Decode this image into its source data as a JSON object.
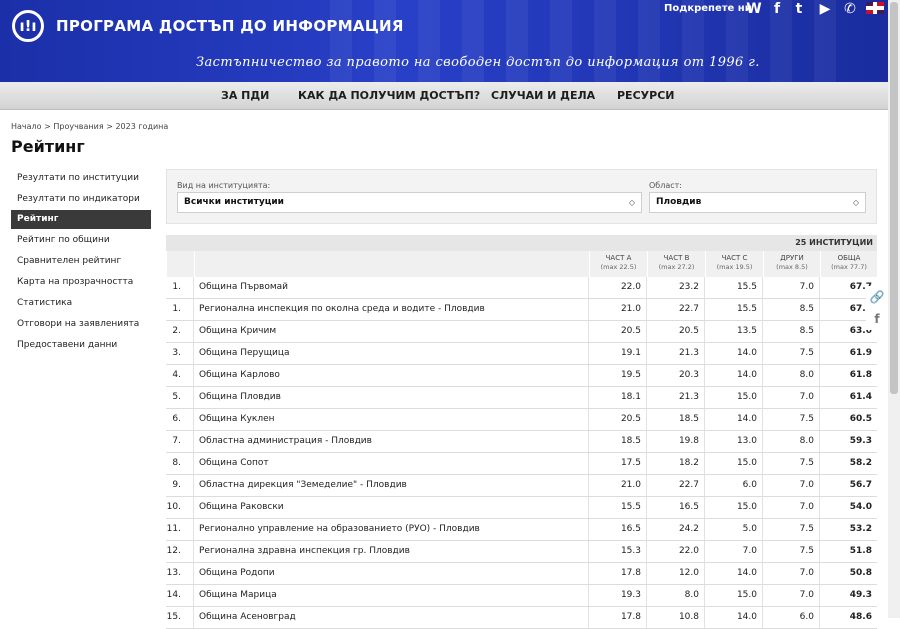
{
  "header": {
    "logo_text": "ı!ı",
    "title": "ПРОГРАМА ДОСТЪП ДО ИНФОРМАЦИЯ",
    "motto": "Застъпничество за правото на свободен достъп до информация от 1996 г.",
    "support_label": "Подкрепете ни",
    "icons": [
      "wordpress-icon",
      "facebook-icon",
      "twitter-icon",
      "youtube-icon",
      "phone-icon",
      "uk-flag-icon"
    ],
    "icon_glyphs": [
      "W",
      "f",
      "t",
      "▶",
      "✆"
    ]
  },
  "nav": {
    "items": [
      "ЗА ПДИ",
      "КАК ДА ПОЛУЧИМ ДОСТЪП?",
      "СЛУЧАИ И ДЕЛА",
      "РЕСУРСИ"
    ]
  },
  "breadcrumb": "Начало > Проучвания > 2023 година",
  "page_title": "Рейтинг",
  "sidebar": {
    "items": [
      "Резултати по институции",
      "Резултати по индикатори",
      "Рейтинг",
      "Рейтинг по общини",
      "Сравнителен рейтинг",
      "Карта на прозрачността",
      "Статистика",
      "Отговори на заявленията",
      "Предоставени данни"
    ],
    "active_index": 2
  },
  "filters": {
    "type_label": "Вид на институцията:",
    "type_value": "Всички институции",
    "region_label": "Област:",
    "region_value": "Пловдив",
    "chevron": "◇"
  },
  "table": {
    "count": "25 ИНСТИТУЦИИ",
    "columns": [
      {
        "label": "ЧАСТ А",
        "sub": "(max 22.5)"
      },
      {
        "label": "ЧАСТ B",
        "sub": "(max 27.2)"
      },
      {
        "label": "ЧАСТ C",
        "sub": "(max 19.5)"
      },
      {
        "label": "ДРУГИ",
        "sub": "(max 8.5)"
      },
      {
        "label": "ОБЩА",
        "sub": "(max 77.7)"
      }
    ],
    "rows": [
      {
        "rank": "1.",
        "name": "Община Първомай",
        "a": "22.0",
        "b": "23.2",
        "c": "15.5",
        "d": "7.0",
        "t": "67.7"
      },
      {
        "rank": "1.",
        "name": "Регионална инспекция по околна среда и водите - Пловдив",
        "a": "21.0",
        "b": "22.7",
        "c": "15.5",
        "d": "8.5",
        "t": "67.7"
      },
      {
        "rank": "2.",
        "name": "Община Кричим",
        "a": "20.5",
        "b": "20.5",
        "c": "13.5",
        "d": "8.5",
        "t": "63.0"
      },
      {
        "rank": "3.",
        "name": "Община Перущица",
        "a": "19.1",
        "b": "21.3",
        "c": "14.0",
        "d": "7.5",
        "t": "61.9"
      },
      {
        "rank": "4.",
        "name": "Община Карлово",
        "a": "19.5",
        "b": "20.3",
        "c": "14.0",
        "d": "8.0",
        "t": "61.8"
      },
      {
        "rank": "5.",
        "name": "Община Пловдив",
        "a": "18.1",
        "b": "21.3",
        "c": "15.0",
        "d": "7.0",
        "t": "61.4"
      },
      {
        "rank": "6.",
        "name": "Община Куклен",
        "a": "20.5",
        "b": "18.5",
        "c": "14.0",
        "d": "7.5",
        "t": "60.5"
      },
      {
        "rank": "7.",
        "name": "Областна администрация - Пловдив",
        "a": "18.5",
        "b": "19.8",
        "c": "13.0",
        "d": "8.0",
        "t": "59.3"
      },
      {
        "rank": "8.",
        "name": "Община Сопот",
        "a": "17.5",
        "b": "18.2",
        "c": "15.0",
        "d": "7.5",
        "t": "58.2"
      },
      {
        "rank": "9.",
        "name": "Областна дирекция \"Земеделие\" - Пловдив",
        "a": "21.0",
        "b": "22.7",
        "c": "6.0",
        "d": "7.0",
        "t": "56.7"
      },
      {
        "rank": "10.",
        "name": "Община Раковски",
        "a": "15.5",
        "b": "16.5",
        "c": "15.0",
        "d": "7.0",
        "t": "54.0"
      },
      {
        "rank": "11.",
        "name": "Регионално управление на образованието (РУО) - Пловдив",
        "a": "16.5",
        "b": "24.2",
        "c": "5.0",
        "d": "7.5",
        "t": "53.2"
      },
      {
        "rank": "12.",
        "name": "Регионална здравна инспекция гр. Пловдив",
        "a": "15.3",
        "b": "22.0",
        "c": "7.0",
        "d": "7.5",
        "t": "51.8"
      },
      {
        "rank": "13.",
        "name": "Община Родопи",
        "a": "17.8",
        "b": "12.0",
        "c": "14.0",
        "d": "7.0",
        "t": "50.8"
      },
      {
        "rank": "14.",
        "name": "Община Марица",
        "a": "19.3",
        "b": "8.0",
        "c": "15.0",
        "d": "7.0",
        "t": "49.3"
      },
      {
        "rank": "15.",
        "name": "Община Асеновград",
        "a": "17.8",
        "b": "10.8",
        "c": "14.0",
        "d": "6.0",
        "t": "48.6"
      }
    ]
  },
  "share": {
    "link_glyph": "🔗",
    "fb_glyph": "f"
  }
}
